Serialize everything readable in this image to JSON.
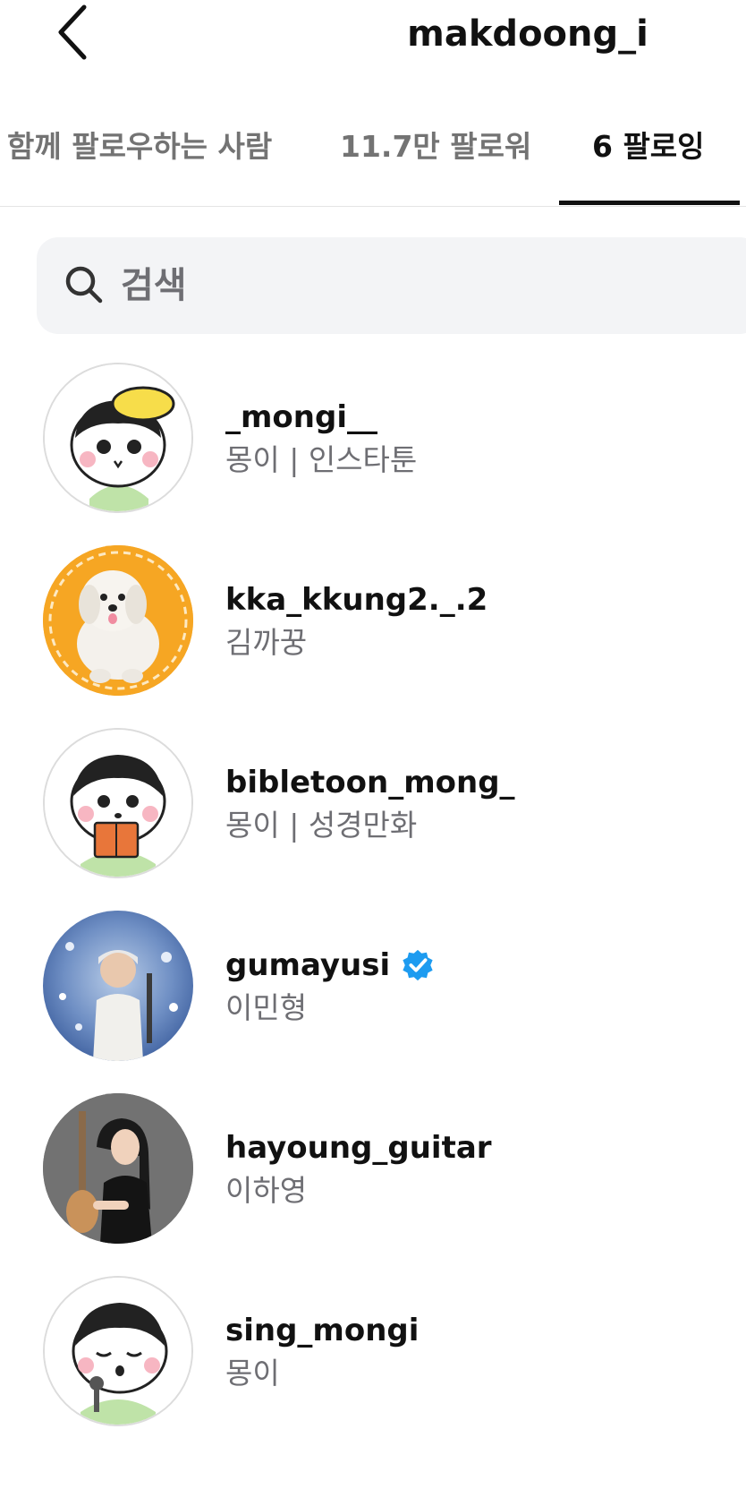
{
  "header": {
    "title": "makdoong_i",
    "back_icon": "chevron-left-icon"
  },
  "tabs": [
    {
      "label": "함께 팔로우하는 사람",
      "active": false
    },
    {
      "label": "11.7만 팔로워",
      "active": false
    },
    {
      "label": "6 팔로잉",
      "active": true
    }
  ],
  "search": {
    "placeholder": "검색",
    "value": "",
    "icon": "search-icon"
  },
  "colors": {
    "accent": "#111111",
    "secondary_text": "#6e6e73",
    "search_bg": "#f3f4f6",
    "verified": "#1d9bf0"
  },
  "following": [
    {
      "username": "_mongi__",
      "name": "몽이 | 인스타툰",
      "verified": false
    },
    {
      "username": "kka_kkung2._.2",
      "name": "김까꿍",
      "verified": false
    },
    {
      "username": "bibletoon_mong_",
      "name": "몽이 | 성경만화",
      "verified": false
    },
    {
      "username": "gumayusi",
      "name": "이민형",
      "verified": true
    },
    {
      "username": "hayoung_guitar",
      "name": "이하영",
      "verified": false
    },
    {
      "username": "sing_mongi",
      "name": "몽이",
      "verified": false
    }
  ]
}
